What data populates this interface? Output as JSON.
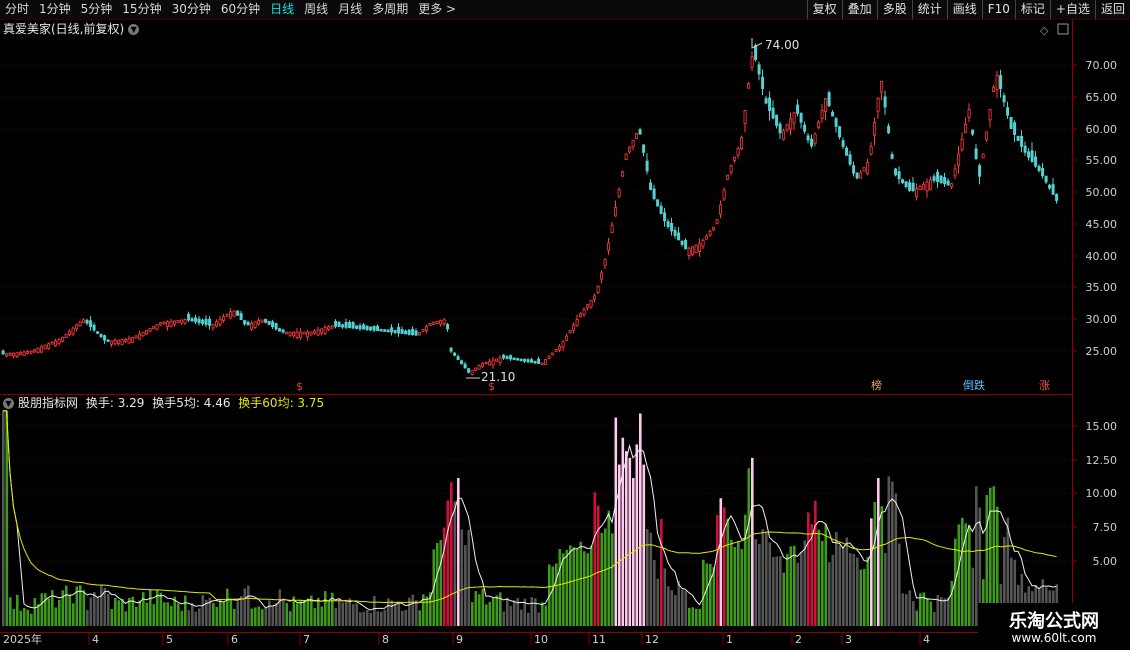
{
  "toolbar": {
    "periods": [
      "分时",
      "1分钟",
      "5分钟",
      "15分钟",
      "30分钟",
      "60分钟",
      "日线",
      "周线",
      "月线",
      "多周期",
      "更多 >"
    ],
    "active_period": "日线",
    "right_buttons": [
      "复权",
      "叠加",
      "多股",
      "统计",
      "画线",
      "F10",
      "标记",
      "+自选",
      "返回"
    ]
  },
  "main_chart": {
    "title": "真爱美家(日线,前复权)",
    "price_ticks": [
      "70.00",
      "65.00",
      "60.00",
      "55.00",
      "50.00",
      "45.00",
      "40.00",
      "35.00",
      "30.00",
      "25.00"
    ],
    "high_label": "74.00",
    "low_label": "21.10",
    "signals": [
      {
        "text": "$",
        "color": "#ff3030"
      },
      {
        "text": "$",
        "color": "#ff3030"
      },
      {
        "text": "榜",
        "color": "#e6a86a"
      },
      {
        "text": "倒跌",
        "color": "#5fbfff"
      },
      {
        "text": "涨",
        "color": "#ff5555"
      }
    ],
    "colors": {
      "up": "#ff3b3b",
      "down": "#54d2d2"
    }
  },
  "indicator": {
    "name": "股朋指标网",
    "items": [
      {
        "label": "换手: 3.29",
        "color": "#e8e8e8"
      },
      {
        "label": "换手5均: 4.46",
        "color": "#e8e8e8"
      },
      {
        "label": "换手60均: 3.75",
        "color": "#e6e600"
      }
    ],
    "ticks": [
      "15.00",
      "12.50",
      "10.00",
      "7.50",
      "5.00"
    ]
  },
  "date_axis": [
    "2025年",
    "4",
    "5",
    "6",
    "7",
    "8",
    "9",
    "10",
    "11",
    "12",
    "1",
    "2",
    "3",
    "4"
  ],
  "watermark": {
    "name": "乐淘公式网",
    "url": "www.60lt.com"
  }
}
